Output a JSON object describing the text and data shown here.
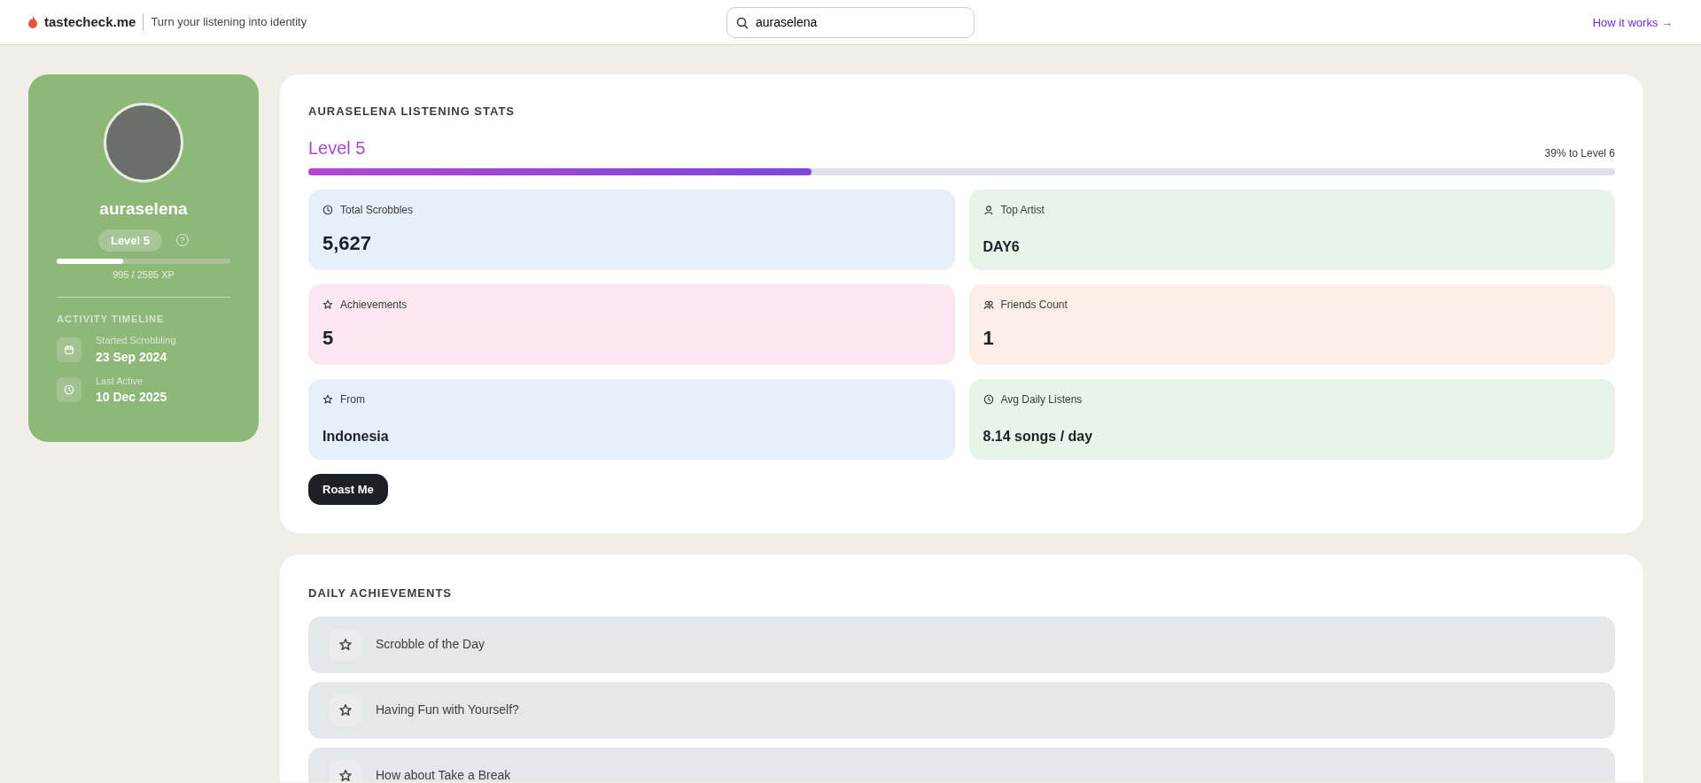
{
  "header": {
    "brand": "tastecheck.me",
    "tagline": "Turn your listening into identity",
    "search": {
      "value": "auraselena"
    },
    "link": "How it works →"
  },
  "profile": {
    "username": "auraselena",
    "level_badge": "Level 5",
    "help": "?",
    "xp": {
      "level": 0.385,
      "reading": "995 / 2585 XP"
    },
    "timeline_title": "ACTIVITY TIMELINE",
    "timeline": [
      {
        "kind": "calendar",
        "label": "Started Scrobbling",
        "value": "23 Sep 2024"
      },
      {
        "kind": "clock",
        "label": "Last Active",
        "value": "10 Dec 2025"
      }
    ]
  },
  "stats": {
    "title": "AURASELENA LISTENING STATS",
    "level_title": "Level 5",
    "progress": {
      "level": 0.385,
      "reading": "39% to Level 6"
    },
    "cards": [
      {
        "kind": "clock",
        "label": "Total Scrobbles",
        "value": "5,627",
        "large": true,
        "color": "#e7effa"
      },
      {
        "kind": "user",
        "label": "Top Artist",
        "value": "DAY6",
        "large": false,
        "color": "#e6f4ea"
      },
      {
        "kind": "star",
        "label": "Achievements",
        "value": "5",
        "large": true,
        "color": "#fbe7ef"
      },
      {
        "kind": "users",
        "label": "Friends Count",
        "value": "1",
        "large": true,
        "color": "#fcf0e6"
      },
      {
        "kind": "star",
        "label": "From",
        "value": "Indonesia",
        "large": false,
        "color": "#e7effa"
      },
      {
        "kind": "clock",
        "label": "Avg Daily Listens",
        "value": "8.14 songs / day",
        "large": false,
        "color": "#e6f4ea"
      }
    ],
    "button": "Roast Me"
  },
  "achievements": {
    "title": "DAILY ACHIEVEMENTS",
    "items": [
      "Scrobble of the Day",
      "Having Fun with Yourself?",
      "How about Take a Break"
    ]
  }
}
